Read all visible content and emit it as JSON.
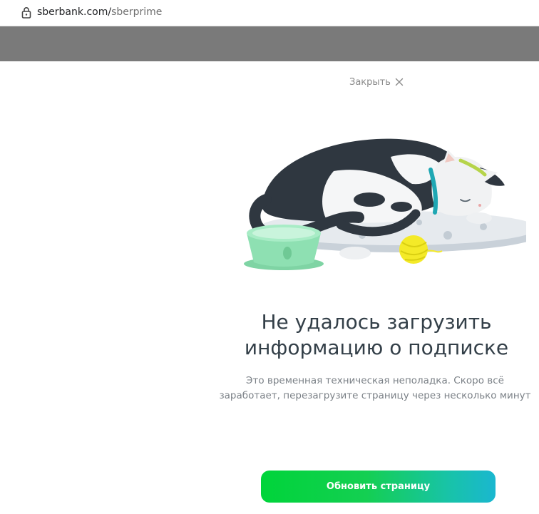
{
  "browser": {
    "url_domain": "sberbank.com/",
    "url_path": "sberprime"
  },
  "close": {
    "label": "Закрыть"
  },
  "error": {
    "title_line1": "Не удалось загрузить",
    "title_line2": "информацию о подписке",
    "description_line1": "Это временная техническая неполадка. Скоро всё",
    "description_line2": "заработает, перезагрузите страницу через несколько минут"
  },
  "actions": {
    "refresh_label": "Обновить страницу"
  },
  "colors": {
    "overlay": "#7a7a7a",
    "title": "#333f48",
    "description": "#7b8187",
    "button_gradient_start": "#00d43a",
    "button_gradient_end": "#1ab7d0"
  },
  "icons": {
    "lock": "lock-icon",
    "close": "close-icon"
  }
}
